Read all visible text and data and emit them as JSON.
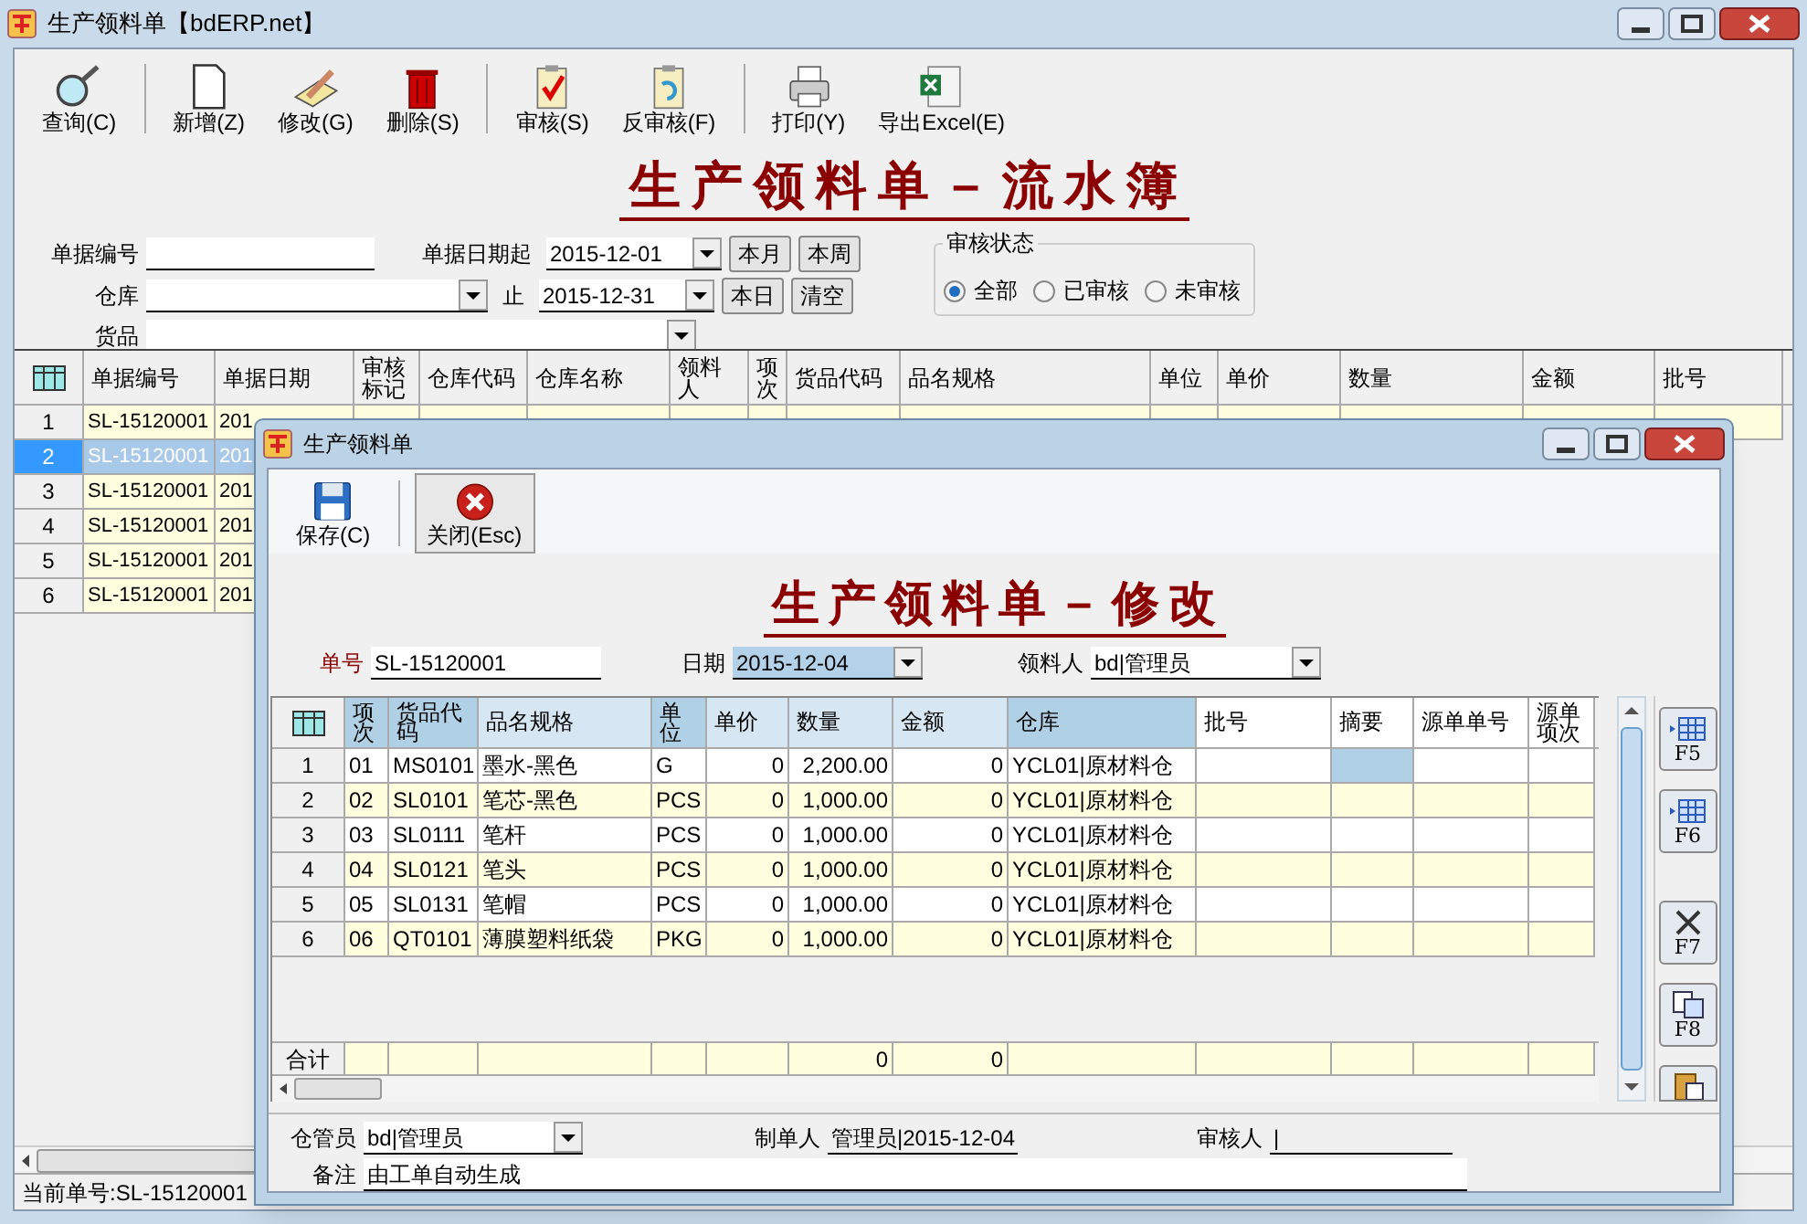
{
  "window": {
    "title": "生产领料单【bdERP.net】"
  },
  "toolbar": [
    {
      "label": "查询(C)"
    },
    {
      "label": "新增(Z)"
    },
    {
      "label": "修改(G)"
    },
    {
      "label": "删除(S)"
    },
    {
      "label": "审核(S)"
    },
    {
      "label": "反审核(F)"
    },
    {
      "label": "打印(Y)"
    },
    {
      "label": "导出Excel(E)"
    }
  ],
  "heading": "生产领料单－流水簿",
  "filters": {
    "doc_no_label": "单据编号",
    "date_from_label": "单据日期起",
    "date_from": "2015-12-01",
    "warehouse_label": "仓库",
    "date_to_label": "止",
    "date_to": "2015-12-31",
    "goods_label": "货品",
    "buttons": [
      "本月",
      "本周",
      "本日",
      "清空"
    ],
    "status_group": {
      "title": "审核状态",
      "options": [
        {
          "label": "全部",
          "selected": true
        },
        {
          "label": "已审核",
          "selected": false
        },
        {
          "label": "未审核",
          "selected": false
        }
      ]
    }
  },
  "grid": {
    "columns": [
      "单据编号",
      "单据日期",
      "审核标记",
      "仓库代码",
      "仓库名称",
      "领料人",
      "项次",
      "货品代码",
      "品名规格",
      "单位",
      "单价",
      "数量",
      "金额",
      "批号"
    ],
    "rows": [
      {
        "no": "1",
        "doc_no": "SL-15120001",
        "date": "201",
        "selected": false
      },
      {
        "no": "2",
        "doc_no": "SL-15120001",
        "date": "201",
        "selected": true
      },
      {
        "no": "3",
        "doc_no": "SL-15120001",
        "date": "201",
        "selected": false
      },
      {
        "no": "4",
        "doc_no": "SL-15120001",
        "date": "201",
        "selected": false
      },
      {
        "no": "5",
        "doc_no": "SL-15120001",
        "date": "201",
        "selected": false
      },
      {
        "no": "6",
        "doc_no": "SL-15120001",
        "date": "201",
        "selected": false
      }
    ]
  },
  "status_bar": "当前单号:SL-15120001",
  "dialog": {
    "title": "生产领料单",
    "toolbar": [
      {
        "label": "保存(C)",
        "pressed": false
      },
      {
        "label": "关闭(Esc)",
        "pressed": true
      }
    ],
    "heading": "生产领料单－修改",
    "doc_no_label": "单号",
    "doc_no": "SL-15120001",
    "date_label": "日期",
    "date": "2015-12-04",
    "picker_label": "领料人",
    "picker": "bd|管理员",
    "columns": [
      "项次",
      "货品代码",
      "品名规格",
      "单位",
      "单价",
      "数量",
      "金额",
      "仓库",
      "批号",
      "摘要",
      "源单单号",
      "源单项次"
    ],
    "rows": [
      {
        "no": "1",
        "cells": [
          "01",
          "MS0101",
          "墨水-黑色",
          "G",
          "0",
          "2,200.00",
          "0",
          "YCL01|原材料仓",
          "",
          "",
          "",
          ""
        ]
      },
      {
        "no": "2",
        "cells": [
          "02",
          "SL0101",
          "笔芯-黑色",
          "PCS",
          "0",
          "1,000.00",
          "0",
          "YCL01|原材料仓",
          "",
          "",
          "",
          ""
        ]
      },
      {
        "no": "3",
        "cells": [
          "03",
          "SL0111",
          "笔杆",
          "PCS",
          "0",
          "1,000.00",
          "0",
          "YCL01|原材料仓",
          "",
          "",
          "",
          ""
        ]
      },
      {
        "no": "4",
        "cells": [
          "04",
          "SL0121",
          "笔头",
          "PCS",
          "0",
          "1,000.00",
          "0",
          "YCL01|原材料仓",
          "",
          "",
          "",
          ""
        ]
      },
      {
        "no": "5",
        "cells": [
          "05",
          "SL0131",
          "笔帽",
          "PCS",
          "0",
          "1,000.00",
          "0",
          "YCL01|原材料仓",
          "",
          "",
          "",
          ""
        ]
      },
      {
        "no": "6",
        "cells": [
          "06",
          "QT0101",
          "薄膜塑料纸袋",
          "PKG",
          "0",
          "1,000.00",
          "0",
          "YCL01|原材料仓",
          "",
          "",
          "",
          ""
        ]
      }
    ],
    "total": {
      "label": "合计",
      "cells": [
        "",
        "",
        "",
        "",
        "",
        "0",
        "0",
        "",
        "",
        "",
        "",
        ""
      ]
    },
    "side_buttons": [
      "F5",
      "F6",
      "F7",
      "F8"
    ],
    "keeper_label": "仓管员",
    "keeper": "bd|管理员",
    "maker_label": "制单人",
    "maker": "管理员|2015-12-04",
    "reviewer_label": "审核人",
    "reviewer": "|",
    "note_label": "备注",
    "note": "由工单自动生成"
  }
}
